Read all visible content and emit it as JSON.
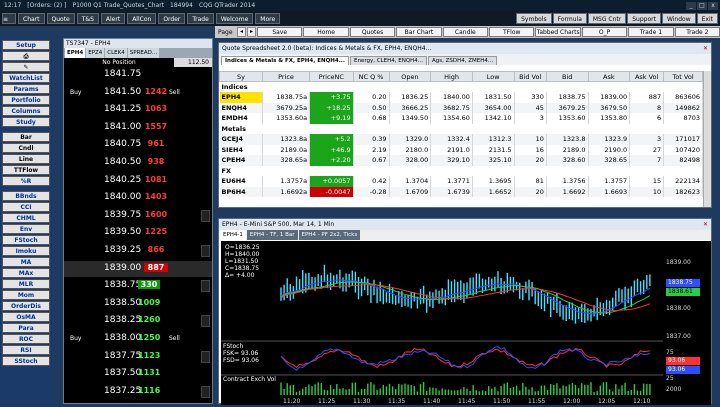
{
  "titlebar": {
    "time": "12:17",
    "orders": "[Orders: (2) ]",
    "account": "P1000 Q1 Trade_Quotes_Chart",
    "build": "184994",
    "app": "CQG QTrader 2014"
  },
  "main_menu": [
    "Chart",
    "Quote",
    "T&S",
    "Alert",
    "AllCon",
    "Order",
    "Trade",
    "Welcome",
    "More"
  ],
  "right_menu": [
    "Symbols",
    "Formula",
    "MSG Cntr",
    "Support",
    "Window",
    "Exit"
  ],
  "workspace": {
    "page_label": "Page",
    "tabs": [
      "Save",
      "Home",
      "Quotes",
      "Bar Chart",
      "Candle",
      "TFlow",
      "Tabbed Charts",
      "O_P",
      "Trade 1",
      "Trade 2"
    ]
  },
  "sidebar": [
    "Setup",
    "WatchList",
    "Params",
    "Portfolio",
    "Columns",
    "Study",
    "Bar",
    "Cndl",
    "Line",
    "TTFlow",
    "%R",
    "BBnds",
    "CCI",
    "CHML",
    "Env",
    "FStoch",
    "Imoku",
    "MA",
    "MAx",
    "MLR",
    "Mom",
    "OrderDis",
    "OsMA",
    "Para",
    "ROC",
    "RSI",
    "SStoch"
  ],
  "dom": {
    "window_id": "TS7347 - EPH4",
    "tabs": [
      "EPH4",
      "EPZ4",
      "CLEK4",
      "SPREAD..."
    ],
    "no_position": "No Position",
    "position_value": "112.50",
    "buy_label": "Buy",
    "sell_label": "Sell",
    "rows": [
      {
        "price": "1841.75",
        "ask": ""
      },
      {
        "price": "1841.50",
        "ask": "1242"
      },
      {
        "price": "1841.25",
        "ask": "1063"
      },
      {
        "price": "1841.00",
        "ask": "1557"
      },
      {
        "price": "1840.75",
        "ask": "961"
      },
      {
        "price": "1840.50",
        "ask": "938"
      },
      {
        "price": "1840.25",
        "ask": "1081"
      },
      {
        "price": "1840.00",
        "ask": "1403"
      },
      {
        "price": "1839.75",
        "ask": "1600"
      },
      {
        "price": "1839.50",
        "ask": "1225"
      },
      {
        "price": "1839.25",
        "ask": "866"
      },
      {
        "price": "1839.00",
        "ask": "887"
      },
      {
        "price": "1838.75",
        "bid": "330"
      },
      {
        "price": "1838.50",
        "bid": "1009"
      },
      {
        "price": "1838.25",
        "bid": "1260"
      },
      {
        "price": "1838.00",
        "bid": "1250"
      },
      {
        "price": "1837.75",
        "bid": "1123"
      },
      {
        "price": "1837.50",
        "bid": "1131"
      },
      {
        "price": "1837.25",
        "bid": "1116"
      }
    ]
  },
  "quote": {
    "title": "Quote Spreadsheet 2.0 (beta): Indices & Metals & FX, EPH4, ENQH4...",
    "tabs": [
      "Indices & Metals & FX, EPH4, ENQH4...",
      "Energy, CLEH4, ENQH4...",
      "Ags, ZSDH4, ZMEH4..."
    ],
    "columns": [
      "Sy",
      "Price",
      "PriceNC",
      "NC Q %",
      "Open",
      "High",
      "Low",
      "Bid Vol",
      "Bid",
      "Ask",
      "Ask Vol",
      "Tot Vol"
    ],
    "groups": [
      {
        "name": "Indices",
        "rows": [
          [
            "EPH4",
            "1838.75a",
            "+3.75",
            "0.20",
            "1836.25",
            "1840.00",
            "1831.50",
            "330",
            "1838.75",
            "1839.00",
            "887",
            "863606"
          ],
          [
            "ENQH4",
            "3679.25a",
            "+18.25",
            "0.50",
            "3666.25",
            "3682.75",
            "3654.00",
            "45",
            "3679.25",
            "3679.50",
            "8",
            "149862"
          ],
          [
            "EMDH4",
            "1353.60a",
            "+9.19",
            "0.68",
            "1349.50",
            "1354.60",
            "1342.10",
            "3",
            "1353.60",
            "1353.80",
            "6",
            "8703"
          ]
        ]
      },
      {
        "name": "Metals",
        "rows": [
          [
            "GCEJ4",
            "1323.8a",
            "+5.2",
            "0.39",
            "1329.0",
            "1332.4",
            "1312.3",
            "10",
            "1323.8",
            "1323.9",
            "3",
            "171017"
          ],
          [
            "SIEH4",
            "2189.0a",
            "+46.9",
            "2.19",
            "2180.0",
            "2191.0",
            "2131.5",
            "16",
            "2189.0",
            "2190.0",
            "27",
            "107420"
          ],
          [
            "CPEH4",
            "328.65a",
            "+2.20",
            "0.67",
            "328.00",
            "329.10",
            "325.10",
            "20",
            "328.60",
            "328.65",
            "7",
            "82498"
          ]
        ]
      },
      {
        "name": "FX",
        "rows": [
          [
            "EU6H4",
            "1.3757a",
            "+0.0057",
            "0.42",
            "1.3704",
            "1.3771",
            "1.3695",
            "81",
            "1.3756",
            "1.3757",
            "15",
            "222134"
          ],
          [
            "BP6H4",
            "1.6692a",
            "-0.0047",
            "-0.28",
            "1.6709",
            "1.6739",
            "1.6652",
            "20",
            "1.6692",
            "1.6693",
            "10",
            "182623"
          ]
        ]
      }
    ]
  },
  "chart": {
    "title": "EPH4 - E-Mini S&P 500, Mar 14, 1 Min",
    "tabs": [
      "EPH4-1",
      "EPH4 - TF, 1 Bar",
      "EPH4 - PF 2x2, Ticks"
    ],
    "ohlc": [
      "O=1836.25",
      "H=1840.00",
      "L=1831.50",
      "C=1838.75",
      "Δ= +4.00"
    ],
    "fstoch_label": "FStoch",
    "fsk": "FSK= 93.06",
    "fsd": "FSD= 93.06",
    "contract_label": "Contract Exch Vol",
    "price_tags": {
      "blue": "1838.75",
      "green": "1838.61"
    },
    "fstoch_tags": [
      "93.06",
      "93.06"
    ],
    "y_ticks": [
      "1839.00",
      "1838.00",
      "1837.00",
      "75",
      "25",
      "2000"
    ],
    "times": [
      "11:20",
      "11:25",
      "11:30",
      "11:35",
      "11:40",
      "11:45",
      "11:50",
      "11:55",
      "12:00",
      "12:05",
      "12:10"
    ],
    "colors": {
      "price": "#40e0ff",
      "ma_blue": "#2d4dff",
      "ma_green": "#2ecc40",
      "ma_red": "#ff3030",
      "background": "#000000"
    }
  }
}
